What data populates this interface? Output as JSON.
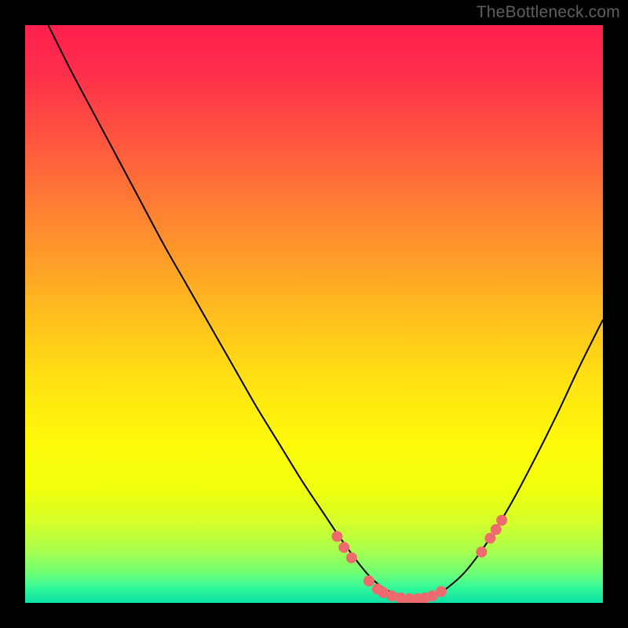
{
  "watermark": "TheBottleneck.com",
  "chart_data": {
    "type": "line",
    "title": "",
    "xlabel": "",
    "ylabel": "",
    "xlim": [
      0,
      100
    ],
    "ylim": [
      0,
      100
    ],
    "series": [
      {
        "name": "curve",
        "x": [
          4,
          8,
          12,
          16,
          20,
          24,
          28,
          32,
          36,
          40,
          44,
          48,
          52,
          54,
          56,
          58,
          60,
          62,
          64,
          66,
          68,
          70,
          72,
          76,
          80,
          84,
          88,
          92,
          96,
          100
        ],
        "y": [
          100,
          92,
          84.5,
          77,
          69.5,
          62,
          55,
          48,
          41,
          34,
          27.5,
          21,
          15,
          12,
          9.2,
          6.5,
          4.2,
          2.6,
          1.5,
          0.9,
          0.7,
          0.9,
          1.8,
          5.2,
          10.5,
          17,
          24.5,
          32.5,
          41,
          49
        ],
        "color": "#000000",
        "stroke_width": 2
      }
    ],
    "markers": [
      {
        "x": 54.0,
        "y": 11.5
      },
      {
        "x": 55.2,
        "y": 9.6
      },
      {
        "x": 56.5,
        "y": 7.8
      },
      {
        "x": 59.5,
        "y": 3.8
      },
      {
        "x": 61.0,
        "y": 2.4
      },
      {
        "x": 62.0,
        "y": 1.8
      },
      {
        "x": 63.5,
        "y": 1.2
      },
      {
        "x": 65.0,
        "y": 0.85
      },
      {
        "x": 66.5,
        "y": 0.72
      },
      {
        "x": 68.0,
        "y": 0.72
      },
      {
        "x": 69.2,
        "y": 0.85
      },
      {
        "x": 70.5,
        "y": 1.2
      },
      {
        "x": 72.0,
        "y": 1.95
      },
      {
        "x": 79.0,
        "y": 8.8
      },
      {
        "x": 80.5,
        "y": 11.2
      },
      {
        "x": 81.5,
        "y": 12.7
      },
      {
        "x": 82.5,
        "y": 14.3
      }
    ],
    "marker_style": {
      "color": "#ef6a6e",
      "radius": 7
    },
    "background": {
      "type": "vertical-gradient",
      "stops": [
        {
          "offset": 0.0,
          "color": "#ff1f4e"
        },
        {
          "offset": 0.08,
          "color": "#ff2e4b"
        },
        {
          "offset": 0.2,
          "color": "#ff5640"
        },
        {
          "offset": 0.35,
          "color": "#ff8a2f"
        },
        {
          "offset": 0.5,
          "color": "#ffbe1e"
        },
        {
          "offset": 0.62,
          "color": "#ffe312"
        },
        {
          "offset": 0.72,
          "color": "#fff90a"
        },
        {
          "offset": 0.8,
          "color": "#f1ff0a"
        },
        {
          "offset": 0.86,
          "color": "#d6ff2a"
        },
        {
          "offset": 0.91,
          "color": "#a8ff4e"
        },
        {
          "offset": 0.95,
          "color": "#6cff78"
        },
        {
          "offset": 0.975,
          "color": "#30f79a"
        },
        {
          "offset": 1.0,
          "color": "#0ae2a5"
        }
      ]
    }
  }
}
